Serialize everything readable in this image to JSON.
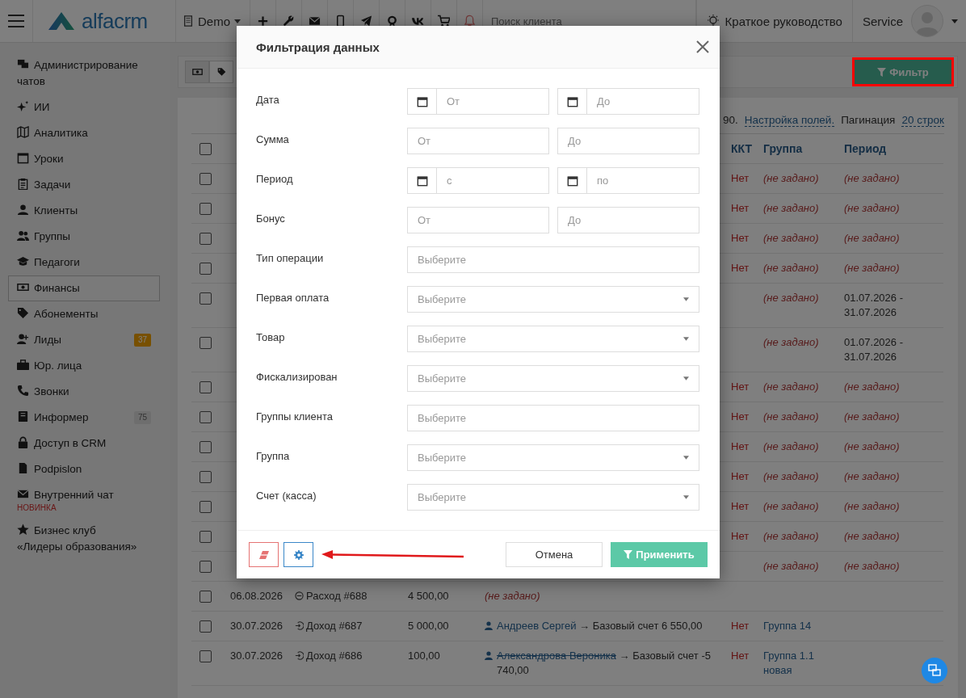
{
  "topbar": {
    "logo": "alfacrm",
    "branch": "Demo",
    "search": {
      "placeholder": "Поиск клиента"
    },
    "guide": "Краткое руководство",
    "user": "Service"
  },
  "sidebar": {
    "items": [
      {
        "label": "Администрирование чатов",
        "selected": false
      },
      {
        "label": "ИИ",
        "selected": false
      },
      {
        "label": "Аналитика",
        "selected": false
      },
      {
        "label": "Уроки",
        "selected": false
      },
      {
        "label": "Задачи",
        "selected": false
      },
      {
        "label": "Клиенты",
        "selected": false
      },
      {
        "label": "Группы",
        "selected": false
      },
      {
        "label": "Педагоги",
        "selected": false
      },
      {
        "label": "Финансы",
        "selected": true
      },
      {
        "label": "Абонементы",
        "selected": false
      },
      {
        "label": "Лиды",
        "selected": false,
        "badge": {
          "text": "37",
          "kind": "warning"
        }
      },
      {
        "label": "Юр. лица",
        "selected": false
      },
      {
        "label": "Звонки",
        "selected": false
      },
      {
        "label": "Информер",
        "selected": false,
        "badge": {
          "text": "75",
          "kind": "neutral"
        }
      },
      {
        "label": "Доступ в CRM",
        "selected": false
      },
      {
        "label": "Podpislon",
        "selected": false
      },
      {
        "label": "Внутренний чат",
        "selected": false,
        "note": "НОВИНКА"
      },
      {
        "label": "Бизнес клуб «Лидеры образования»",
        "selected": false
      }
    ]
  },
  "toolbar": {
    "view_tabs": [
      {
        "selected": true
      },
      {
        "selected": false
      }
    ],
    "filter_button": "Фильтр",
    "highlighted": true
  },
  "summary": {
    "tail": "90.",
    "settings_link": "Настройка полей.",
    "pagination_label": "Пагинация",
    "pagination_link": "20 строк"
  },
  "table": {
    "all_checked": false,
    "header": {
      "kkt": "ККТ",
      "group": "Группа",
      "period": "Период"
    },
    "rows": [
      {
        "checked": false,
        "kkt": "Нет",
        "group": {
          "text": "(не задано)",
          "unset": true
        },
        "period": {
          "text": "(не задано)",
          "unset": true
        }
      },
      {
        "checked": false,
        "kkt": "Нет",
        "group": {
          "text": "(не задано)",
          "unset": true
        },
        "period": {
          "text": "(не задано)",
          "unset": true
        }
      },
      {
        "checked": false,
        "kkt": "Нет",
        "group": {
          "text": "(не задано)",
          "unset": true
        },
        "period": {
          "text": "(не задано)",
          "unset": true
        }
      },
      {
        "checked": false,
        "kkt": "Нет",
        "group": {
          "text": "(не задано)",
          "unset": true
        },
        "period": {
          "text": "(не задано)",
          "unset": true
        }
      },
      {
        "checked": false,
        "group": {
          "text": "(не задано)",
          "unset": true
        },
        "period": {
          "text": "01.07.2026 - 31.07.2026",
          "unset": false
        }
      },
      {
        "checked": false,
        "group": {
          "text": "(не задано)",
          "unset": true
        },
        "period": {
          "text": "01.07.2026 - 31.07.2026",
          "unset": false
        }
      },
      {
        "checked": false,
        "kkt": "Нет",
        "group": {
          "text": "(не задано)",
          "unset": true
        },
        "period": {
          "text": "(не задано)",
          "unset": true
        }
      },
      {
        "checked": false,
        "kkt": "Нет",
        "group": {
          "text": "(не задано)",
          "unset": true
        },
        "period": {
          "text": "(не задано)",
          "unset": true
        }
      },
      {
        "checked": false,
        "kkt": "Нет",
        "group": {
          "text": "(не задано)",
          "unset": true
        },
        "period": {
          "text": "(не задано)",
          "unset": true
        }
      },
      {
        "checked": false,
        "kkt": "Нет",
        "group": {
          "text": "(не задано)",
          "unset": true
        },
        "period": {
          "text": "(не задано)",
          "unset": true
        }
      },
      {
        "checked": false,
        "kkt": "Нет",
        "group": {
          "text": "(не задано)",
          "unset": true
        },
        "period": {
          "text": "(не задано)",
          "unset": true
        }
      },
      {
        "checked": false,
        "kkt": "Нет",
        "group": {
          "text": "(не задано)",
          "unset": true
        },
        "period": {
          "text": "(не задано)",
          "unset": true
        }
      },
      {
        "checked": false,
        "group": {
          "text": "(не задано)",
          "unset": true
        },
        "period": {
          "text": "(не задано)",
          "unset": true
        }
      },
      {
        "checked": false,
        "date": "06.08.2026",
        "operation": {
          "kind": "expense",
          "label": "Расход #688"
        },
        "sum": "4 500,00",
        "client": {
          "kind": "unset",
          "text": "(не задано)"
        }
      },
      {
        "checked": false,
        "date": "30.07.2026",
        "operation": {
          "kind": "income",
          "label": "Доход #687"
        },
        "sum": "5 000,00",
        "client": {
          "kind": "transfer",
          "name": "Андреев Сергей",
          "archived": false,
          "arrow": "→",
          "account": "Базовый счет 6 550,00"
        },
        "kkt": "Нет",
        "group": {
          "text": "Группа 14",
          "unset": false
        }
      },
      {
        "checked": false,
        "date": "30.07.2026",
        "operation": {
          "kind": "income",
          "label": "Доход #686"
        },
        "sum": "100,00",
        "client": {
          "kind": "transfer",
          "name": "Александрова Вероника",
          "archived": true,
          "arrow": "→",
          "account": "Базовый счет -5 740,00"
        },
        "kkt": "Нет",
        "group": {
          "text": "Группа 1.1 новая",
          "unset": false
        }
      }
    ]
  },
  "filter_dialog": {
    "title": "Фильтрация данных",
    "fields": [
      {
        "label": "Дата",
        "kind": "date_range",
        "placeholders": [
          "От",
          "До"
        ]
      },
      {
        "label": "Сумма",
        "kind": "range",
        "placeholders": [
          "От",
          "До"
        ]
      },
      {
        "label": "Период",
        "kind": "date_range",
        "placeholders": [
          "с",
          "по"
        ]
      },
      {
        "label": "Бонус",
        "kind": "range",
        "placeholders": [
          "От",
          "До"
        ]
      },
      {
        "label": "Тип операции",
        "kind": "multiselect",
        "placeholder": "Выберите"
      },
      {
        "label": "Первая оплата",
        "kind": "select",
        "placeholder": "Выберите"
      },
      {
        "label": "Товар",
        "kind": "select",
        "placeholder": "Выберите"
      },
      {
        "label": "Фискализирован",
        "kind": "select",
        "placeholder": "Выберите"
      },
      {
        "label": "Группы клиента",
        "kind": "multiselect",
        "placeholder": "Выберите"
      },
      {
        "label": "Группа",
        "kind": "select",
        "placeholder": "Выберите"
      },
      {
        "label": "Счет (касса)",
        "kind": "select",
        "placeholder": "Выберите"
      }
    ],
    "annotation_arrow": true,
    "cancel": "Отмена",
    "apply": "Применить"
  }
}
